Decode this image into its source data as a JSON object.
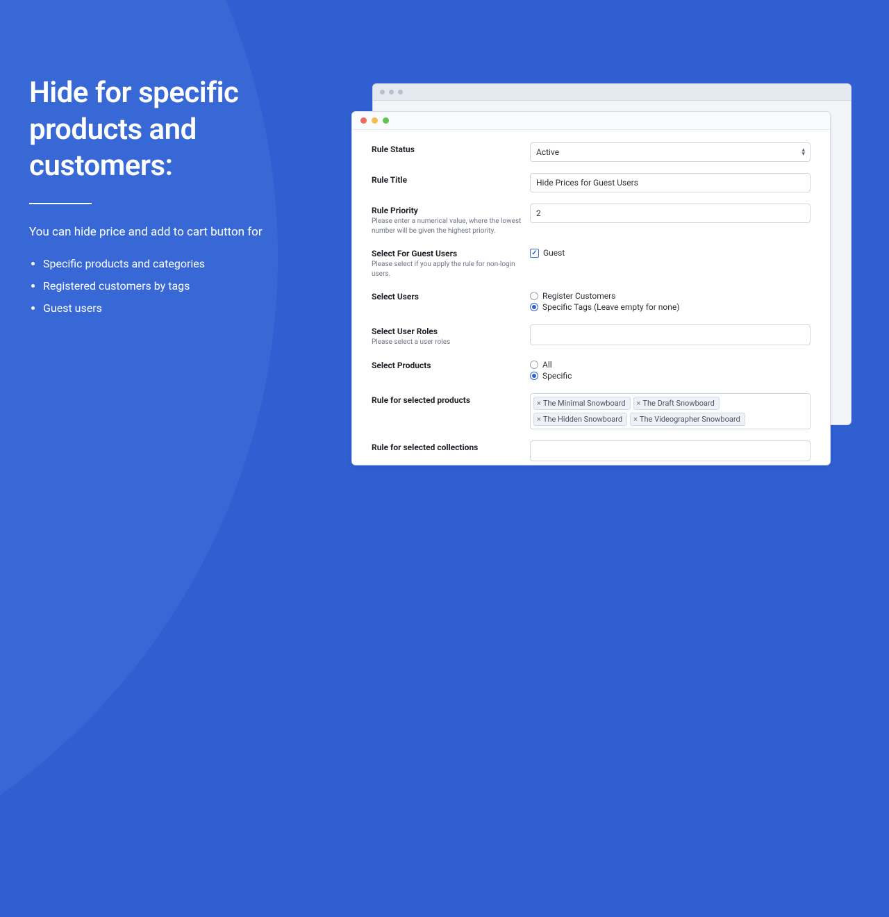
{
  "marketing": {
    "headline": "Hide for specific products and customers:",
    "subhead": "You can hide price and add to cart button for",
    "bullets": [
      "Specific products and categories",
      "Registered customers by tags",
      "Guest users"
    ]
  },
  "form": {
    "rule_status": {
      "label": "Rule Status",
      "value": "Active"
    },
    "rule_title": {
      "label": "Rule Title",
      "value": "Hide Prices for Guest Users"
    },
    "rule_priority": {
      "label": "Rule Priority",
      "help": "Please enter a numerical value, where the lowest number will be given the highest priority.",
      "value": "2"
    },
    "guest_users": {
      "label": "Select For Guest Users",
      "help": "Please select if you apply the rule for non-login users.",
      "checkbox_label": "Guest",
      "checked": true
    },
    "select_users": {
      "label": "Select Users",
      "options": [
        "Register Customers",
        "Specific Tags (Leave empty for none)"
      ],
      "selected": 1
    },
    "user_roles": {
      "label": "Select User Roles",
      "help": "Please select a user roles"
    },
    "select_products": {
      "label": "Select Products",
      "options": [
        "All",
        "Specific"
      ],
      "selected": 1
    },
    "selected_products": {
      "label": "Rule for selected products",
      "tags": [
        "The Minimal Snowboard",
        "The Draft Snowboard",
        "The Hidden Snowboard",
        "The Videographer Snowboard"
      ]
    },
    "selected_collections": {
      "label": "Rule for selected collections"
    }
  }
}
